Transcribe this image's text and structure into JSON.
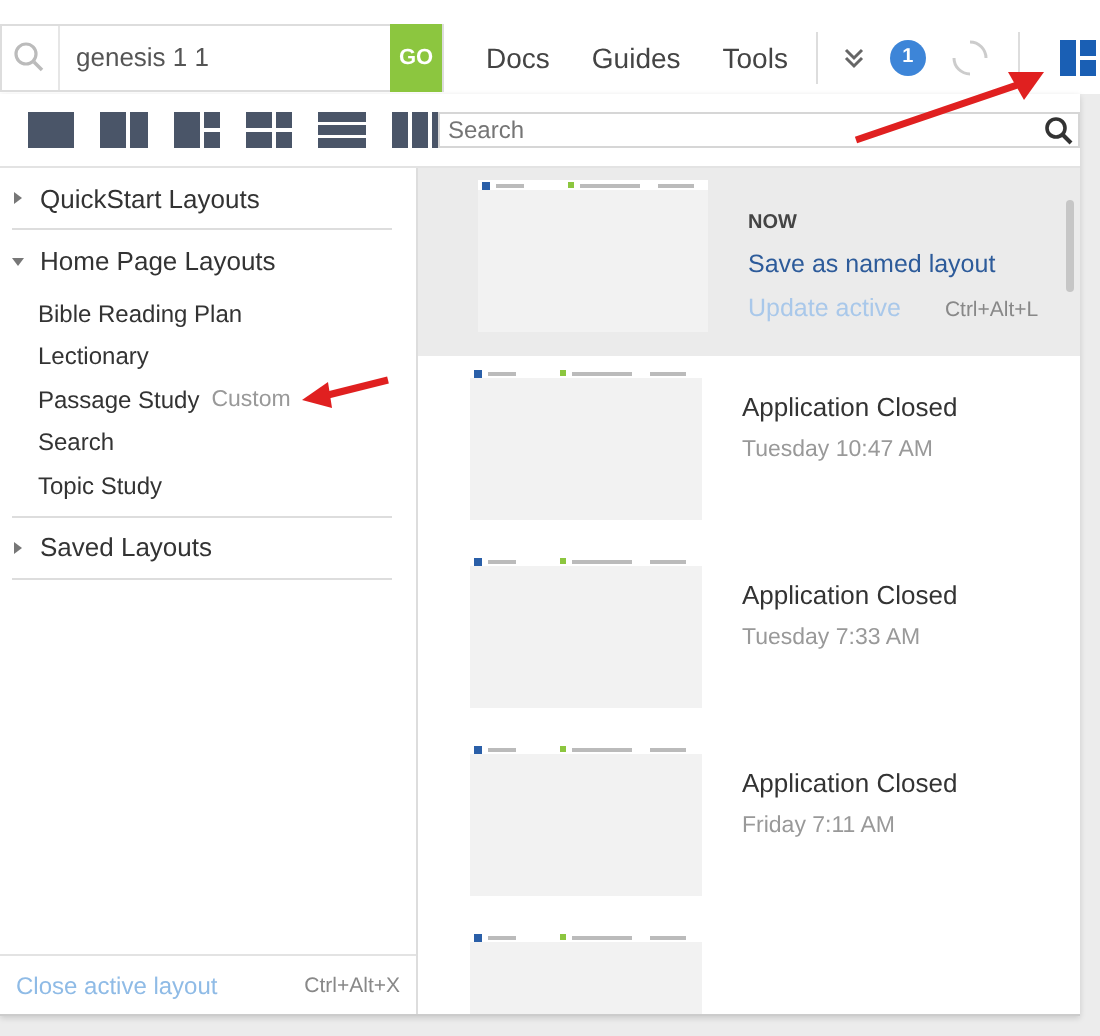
{
  "search": {
    "value": "genesis 1 1",
    "button": "GO"
  },
  "nav": [
    "Docs",
    "Guides",
    "Tools"
  ],
  "notification_badge": "1",
  "layout_search": {
    "placeholder": "Search"
  },
  "sidebar": [
    {
      "label": "QuickStart Layouts",
      "expanded": false
    },
    {
      "label": "Home Page Layouts",
      "expanded": true,
      "items": [
        {
          "label": "Bible Reading Plan"
        },
        {
          "label": "Lectionary"
        },
        {
          "label": "Passage Study",
          "tag": "Custom"
        },
        {
          "label": "Search"
        },
        {
          "label": "Topic Study"
        }
      ]
    },
    {
      "label": "Saved Layouts",
      "expanded": false
    }
  ],
  "history": [
    {
      "kind": "current",
      "heading": "NOW",
      "action": "Save as named layout",
      "secondary": "Update active",
      "secondary_disabled": true,
      "shortcut": "Ctrl+Alt+L"
    },
    {
      "kind": "entry",
      "title": "Application Closed",
      "time": "Tuesday 10:47 AM"
    },
    {
      "kind": "entry",
      "title": "Application Closed",
      "time": "Tuesday 7:33 AM"
    },
    {
      "kind": "entry",
      "title": "Application Closed",
      "time": "Friday 7:11 AM"
    },
    {
      "kind": "cut"
    }
  ],
  "footer": {
    "action": "Close active layout",
    "shortcut": "Ctrl+Alt+X"
  }
}
